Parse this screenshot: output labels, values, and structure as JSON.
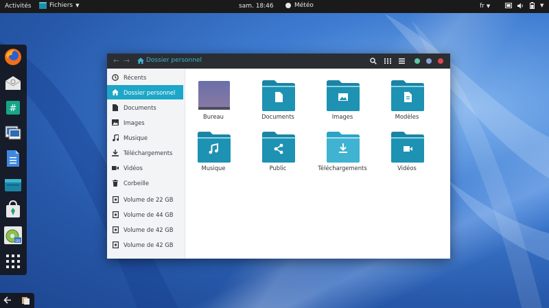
{
  "topbar": {
    "activities": "Activités",
    "app_name": "Fichiers",
    "clock": "sam. 18:46",
    "weather": "Météo",
    "lang": "fr"
  },
  "dock": {
    "items": [
      "firefox-icon",
      "mail-icon",
      "chat-icon",
      "photos-icon",
      "document-icon",
      "files-icon",
      "software-icon",
      "disc-icon",
      "app-grid-icon"
    ]
  },
  "window": {
    "path_label": "Dossier personnel",
    "colors": {
      "accent": "#1da6c8",
      "folder": "#1a84a4",
      "folder_light": "#3fb3d1",
      "close": "#e0474c",
      "min": "#5ec7a4",
      "max": "#8aa3d6"
    }
  },
  "sidebar": {
    "items": [
      {
        "label": "Récents",
        "icon": "clock-icon"
      },
      {
        "label": "Dossier personnel",
        "icon": "home-icon"
      },
      {
        "label": "Documents",
        "icon": "document-icon"
      },
      {
        "label": "Images",
        "icon": "image-icon"
      },
      {
        "label": "Musique",
        "icon": "music-icon"
      },
      {
        "label": "Téléchargements",
        "icon": "download-icon"
      },
      {
        "label": "Vidéos",
        "icon": "video-icon"
      },
      {
        "label": "Corbeille",
        "icon": "trash-icon"
      },
      {
        "label": "Volume de 22 GB",
        "icon": "drive-icon"
      },
      {
        "label": "Volume de 44 GB",
        "icon": "drive-icon"
      },
      {
        "label": "Volume de 42 GB",
        "icon": "drive-icon"
      },
      {
        "label": "Volume de 42 GB",
        "icon": "drive-icon"
      }
    ]
  },
  "folders": [
    {
      "label": "Bureau",
      "icon": "desktop-icon"
    },
    {
      "label": "Documents",
      "icon": "document-icon"
    },
    {
      "label": "Images",
      "icon": "image-icon"
    },
    {
      "label": "Modèles",
      "icon": "template-icon"
    },
    {
      "label": "Musique",
      "icon": "music-icon"
    },
    {
      "label": "Public",
      "icon": "share-icon"
    },
    {
      "label": "Téléchargements",
      "icon": "download-icon"
    },
    {
      "label": "Vidéos",
      "icon": "video-icon"
    }
  ]
}
